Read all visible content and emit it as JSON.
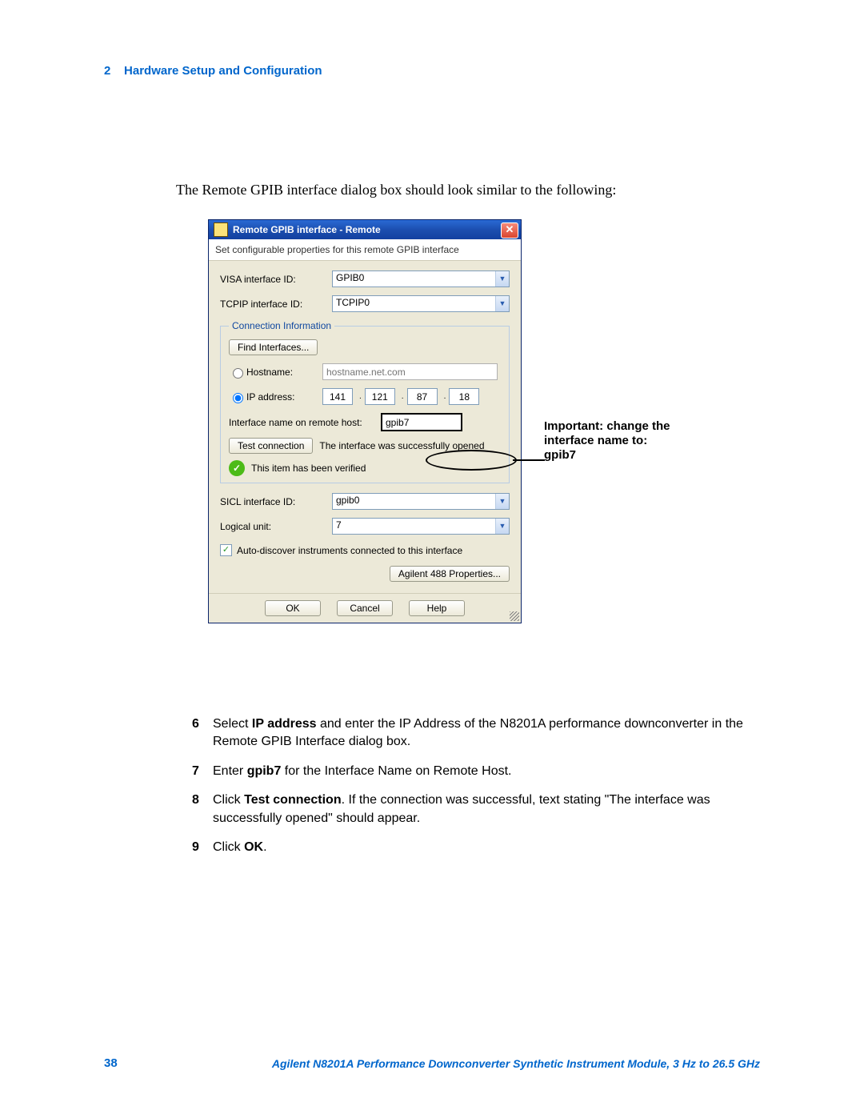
{
  "header": {
    "chapter_num": "2",
    "chapter_title": "Hardware Setup and Configuration"
  },
  "intro_text": "The Remote GPIB interface dialog box should look similar to the following:",
  "dialog": {
    "title": "Remote GPIB interface - Remote",
    "subtitle": "Set configurable properties for this remote GPIB interface",
    "visa_label": "VISA interface ID:",
    "visa_value": "GPIB0",
    "tcpip_label": "TCPIP interface ID:",
    "tcpip_value": "TCPIP0",
    "conn_legend": "Connection Information",
    "find_btn": "Find Interfaces...",
    "hostname_label": "Hostname:",
    "hostname_placeholder": "hostname.net.com",
    "ip_label": "IP address:",
    "ip": [
      "141",
      "121",
      "87",
      "18"
    ],
    "iface_label": "Interface name on remote host:",
    "iface_value": "gpib7",
    "test_btn": "Test connection",
    "test_result": "The interface was successfully opened",
    "verified_text": "This item has been verified",
    "sicl_label": "SICL interface ID:",
    "sicl_value": "gpib0",
    "lu_label": "Logical unit:",
    "lu_value": "7",
    "autodiscover": "Auto-discover instruments connected to this interface",
    "agilent_btn": "Agilent 488 Properties...",
    "ok_btn": "OK",
    "cancel_btn": "Cancel",
    "help_btn": "Help"
  },
  "callout": {
    "line1": "Important: change the",
    "line2": "interface name to:",
    "line3": "gpib7"
  },
  "steps": [
    {
      "num": "6",
      "html": "Select <b>IP address</b> and enter the IP Address of the N8201A performance downconverter in the Remote GPIB Interface dialog box."
    },
    {
      "num": "7",
      "html": "Enter <b>gpib7</b> for the Interface Name on Remote Host."
    },
    {
      "num": "8",
      "html": "Click <b>Test connection</b>. If the connection was successful, text stating \"The interface was successfully opened\" should appear."
    },
    {
      "num": "9",
      "html": "Click <b>OK</b>."
    }
  ],
  "footer": {
    "page_num": "38",
    "doc_title": "Agilent N8201A Performance Downconverter Synthetic Instrument Module, 3 Hz to 26.5 GHz"
  }
}
